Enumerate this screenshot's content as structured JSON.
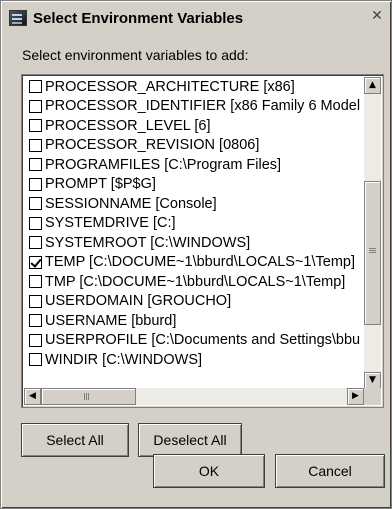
{
  "window": {
    "title": "Select Environment Variables",
    "close_glyph": "✕"
  },
  "prompt": "Select environment variables to add:",
  "variables": [
    {
      "label": "PROCESSOR_ARCHITECTURE [x86]",
      "checked": false
    },
    {
      "label": "PROCESSOR_IDENTIFIER [x86 Family 6 Model",
      "checked": false
    },
    {
      "label": "PROCESSOR_LEVEL [6]",
      "checked": false
    },
    {
      "label": "PROCESSOR_REVISION [0806]",
      "checked": false
    },
    {
      "label": "PROGRAMFILES [C:\\Program Files]",
      "checked": false
    },
    {
      "label": "PROMPT [$P$G]",
      "checked": false
    },
    {
      "label": "SESSIONNAME [Console]",
      "checked": false
    },
    {
      "label": "SYSTEMDRIVE [C:]",
      "checked": false
    },
    {
      "label": "SYSTEMROOT [C:\\WINDOWS]",
      "checked": false
    },
    {
      "label": "TEMP [C:\\DOCUME~1\\bburd\\LOCALS~1\\Temp]",
      "checked": true
    },
    {
      "label": "TMP [C:\\DOCUME~1\\bburd\\LOCALS~1\\Temp]",
      "checked": false
    },
    {
      "label": "USERDOMAIN [GROUCHO]",
      "checked": false
    },
    {
      "label": "USERNAME [bburd]",
      "checked": false
    },
    {
      "label": "USERPROFILE [C:\\Documents and Settings\\bbu",
      "checked": false
    },
    {
      "label": "WINDIR [C:\\WINDOWS]",
      "checked": false
    }
  ],
  "scrollbar": {
    "up_glyph": "▲",
    "down_glyph": "▼",
    "left_glyph": "◀",
    "right_glyph": "▶"
  },
  "buttons": {
    "select_all": "Select All",
    "deselect_all": "Deselect All",
    "ok": "OK",
    "cancel": "Cancel"
  },
  "colors": {
    "dialog_bg": "#d4d0c8",
    "list_bg": "#ffffff"
  }
}
